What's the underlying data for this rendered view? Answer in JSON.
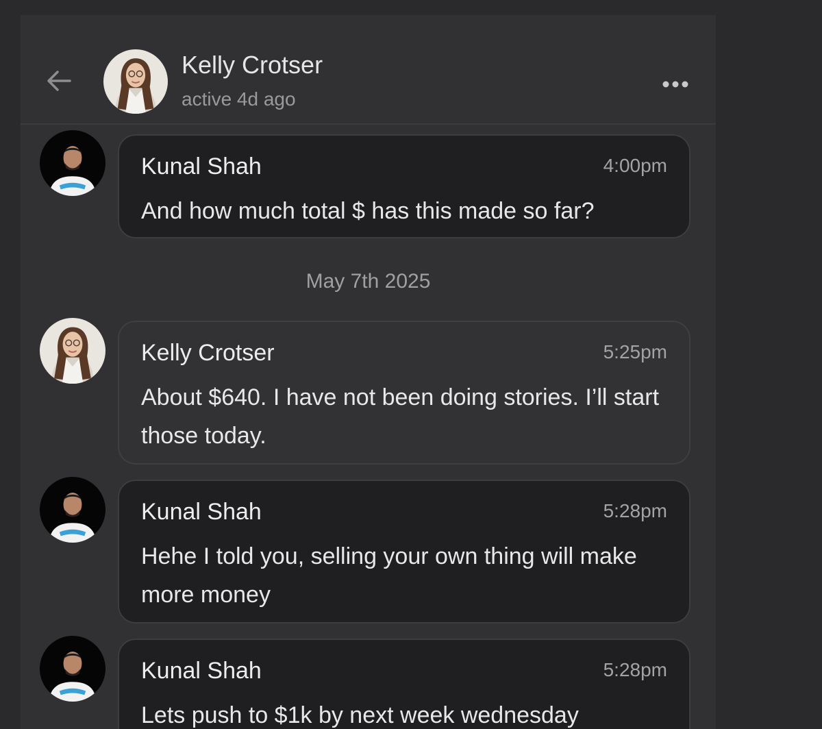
{
  "header": {
    "back_icon": "arrow-left-icon",
    "name": "Kelly Crotser",
    "status": "active 4d ago",
    "more_icon": "more-horizontal-icon"
  },
  "date_separator": "May 7th 2025",
  "messages": [
    {
      "sender": "Kunal Shah",
      "time": "4:00pm",
      "text": "And how much total $ has this made so far?"
    },
    {
      "sender": "Kelly Crotser",
      "time": "5:25pm",
      "text": "About $640. I have not been doing stories. I’ll start those today."
    },
    {
      "sender": "Kunal Shah",
      "time": "5:28pm",
      "text": "Hehe I told you, selling your own thing will make more money"
    },
    {
      "sender": "Kunal Shah",
      "time": "5:28pm",
      "text": "Lets push to $1k by next week wednesday"
    }
  ],
  "colors": {
    "background": "#2a2a2c",
    "panel": "#313133",
    "bubble_own": "#1f1f21",
    "bubble_other": "#323234",
    "text_primary": "#e8e8e8",
    "text_secondary": "#a0a0a2"
  }
}
